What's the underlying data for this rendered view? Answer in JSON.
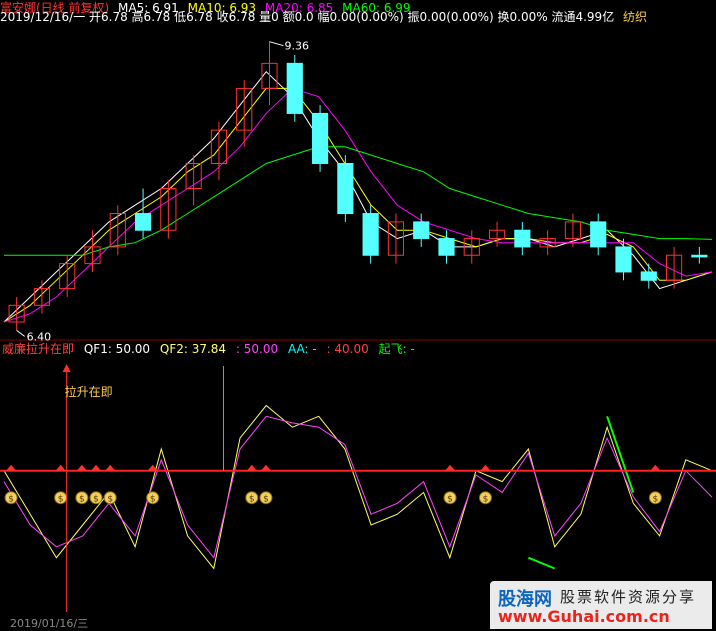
{
  "info_bar": {
    "name_period": "富安娜(日线 前复权)",
    "ma5": "MA5: 6.91",
    "ma10": "MA10: 6.93",
    "ma20": "MA20: 6.85",
    "ma60": "MA60: 6.99",
    "date_line": "2019/12/16/一 开6.78 高6.78 低6.78 收6.78 量0 额0.0 幅0.00(0.00%) 振0.00(0.00%) 换0.00% 流通4.99亿",
    "industry": "纺织"
  },
  "colors": {
    "ma5": "#ffffff",
    "ma10": "#ffff00",
    "ma20": "#ff00ff",
    "ma60": "#00ff00",
    "up": "#ff3232",
    "down": "#54ffff",
    "threshold": "#ff2020",
    "qf1": "#ffff66",
    "qf2": "#ff44ff",
    "aa": "#00ff00",
    "grid": "#8b0000"
  },
  "indicator": {
    "title": "威廉拉升在即",
    "qf1": "QF1: 50.00",
    "qf2_label": "QF2: 37.84",
    "qf2_value": ": 50.00",
    "aa": "AA: -",
    "aa_value": ": 40.00",
    "takeoff": "起飞: -",
    "annotation": "拉升在即"
  },
  "chart_data": [
    {
      "type": "candlestick",
      "title": "富安娜(日线 前复权)",
      "high_label": "9.36",
      "low_label": "6.40",
      "series": [
        {
          "name": "MA5",
          "values": [
            6.0,
            6.3,
            6.6,
            6.9,
            7.2,
            7.4,
            7.6,
            7.9,
            8.2,
            8.6,
            9.0,
            8.7,
            8.2,
            7.8,
            7.2,
            7.0,
            7.1,
            6.9,
            6.9,
            7.0,
            7.0,
            6.9,
            7.0,
            7.1,
            6.8,
            6.4,
            6.5,
            6.6
          ]
        },
        {
          "name": "MA10",
          "values": [
            6.0,
            6.2,
            6.5,
            6.8,
            7.1,
            7.3,
            7.5,
            7.8,
            8.0,
            8.4,
            8.8,
            8.8,
            8.4,
            7.9,
            7.4,
            7.1,
            7.1,
            7.0,
            6.9,
            7.0,
            7.0,
            6.95,
            6.95,
            7.05,
            6.9,
            6.5,
            6.5,
            6.6
          ]
        },
        {
          "name": "MA20",
          "values": [
            6.0,
            6.1,
            6.3,
            6.6,
            6.9,
            7.2,
            7.4,
            7.6,
            7.8,
            8.1,
            8.5,
            8.8,
            8.7,
            8.3,
            7.8,
            7.4,
            7.2,
            7.1,
            7.0,
            6.95,
            6.95,
            6.95,
            6.95,
            6.95,
            6.95,
            6.7,
            6.55,
            6.6
          ]
        },
        {
          "name": "MA60",
          "values": [
            6.8,
            6.8,
            6.8,
            6.8,
            6.9,
            6.95,
            7.1,
            7.3,
            7.5,
            7.7,
            7.9,
            8.0,
            8.1,
            8.1,
            8.0,
            7.9,
            7.8,
            7.6,
            7.5,
            7.4,
            7.3,
            7.25,
            7.2,
            7.1,
            7.05,
            7.0,
            7.0,
            6.99
          ]
        }
      ],
      "candles": [
        [
          6.0,
          6.3,
          5.9,
          6.2
        ],
        [
          6.2,
          6.5,
          6.1,
          6.4
        ],
        [
          6.4,
          6.8,
          6.3,
          6.7
        ],
        [
          6.7,
          7.1,
          6.6,
          6.9
        ],
        [
          6.9,
          7.4,
          6.8,
          7.3
        ],
        [
          7.3,
          7.6,
          7.0,
          7.1
        ],
        [
          7.1,
          7.7,
          7.0,
          7.6
        ],
        [
          7.6,
          8.0,
          7.4,
          7.9
        ],
        [
          7.9,
          8.4,
          7.7,
          8.3
        ],
        [
          8.3,
          8.9,
          8.1,
          8.8
        ],
        [
          8.8,
          9.36,
          8.6,
          9.1
        ],
        [
          9.1,
          9.2,
          8.4,
          8.5
        ],
        [
          8.5,
          8.6,
          7.8,
          7.9
        ],
        [
          7.9,
          8.0,
          7.2,
          7.3
        ],
        [
          7.3,
          7.4,
          6.7,
          6.8
        ],
        [
          6.8,
          7.3,
          6.7,
          7.2
        ],
        [
          7.2,
          7.3,
          6.9,
          7.0
        ],
        [
          7.0,
          7.1,
          6.7,
          6.8
        ],
        [
          6.8,
          7.1,
          6.7,
          7.0
        ],
        [
          7.0,
          7.2,
          6.9,
          7.1
        ],
        [
          7.1,
          7.2,
          6.8,
          6.9
        ],
        [
          6.9,
          7.1,
          6.8,
          7.0
        ],
        [
          7.0,
          7.3,
          6.9,
          7.2
        ],
        [
          7.2,
          7.3,
          6.8,
          6.9
        ],
        [
          6.9,
          7.0,
          6.5,
          6.6
        ],
        [
          6.6,
          6.7,
          6.4,
          6.5
        ],
        [
          6.5,
          6.9,
          6.4,
          6.8
        ],
        [
          6.8,
          6.9,
          6.7,
          6.78
        ]
      ],
      "ylim": [
        6.0,
        9.5
      ]
    },
    {
      "type": "line",
      "title": "威廉拉升在即",
      "threshold": 50,
      "ylim": [
        -15,
        100
      ],
      "series": [
        {
          "name": "QF1",
          "values": [
            50,
            30,
            10,
            25,
            40,
            15,
            60,
            20,
            5,
            65,
            80,
            70,
            75,
            60,
            25,
            30,
            40,
            10,
            50,
            45,
            60,
            15,
            30,
            70,
            35,
            20,
            55,
            50
          ]
        },
        {
          "name": "QF2",
          "values": [
            45,
            25,
            15,
            20,
            35,
            20,
            55,
            25,
            10,
            60,
            75,
            72,
            70,
            62,
            30,
            35,
            45,
            15,
            48,
            40,
            58,
            20,
            35,
            65,
            38,
            22,
            50,
            37.84
          ]
        },
        {
          "name": "AA",
          "values": [
            null,
            null,
            null,
            null,
            null,
            null,
            null,
            null,
            null,
            null,
            null,
            null,
            null,
            null,
            null,
            null,
            null,
            null,
            null,
            null,
            10,
            5,
            null,
            75,
            40,
            null,
            null,
            40
          ]
        }
      ],
      "signals": [
        1,
        8,
        11,
        13,
        15,
        21,
        35,
        37,
        63,
        68,
        92
      ]
    }
  ],
  "watermark": {
    "brand": "股海网",
    "slogan": "股票软件资源分享",
    "url": "www.Guhai.com.cn"
  },
  "footer_date": "2019/01/16/三"
}
